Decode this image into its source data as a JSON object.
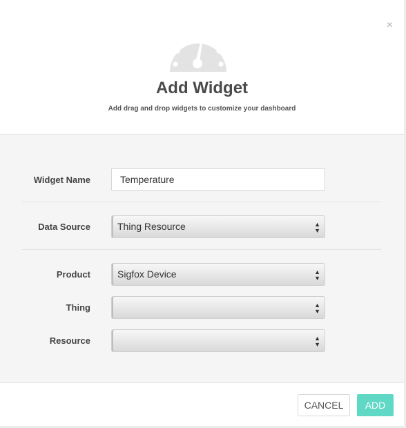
{
  "dialog": {
    "title": "Add Widget",
    "subtitle": "Add drag and drop widgets to customize your dashboard",
    "close_symbol": "×",
    "icon": "gauge-icon"
  },
  "form": {
    "widget_name": {
      "label": "Widget Name",
      "value": "Temperature"
    },
    "data_source": {
      "label": "Data Source",
      "value": "Thing Resource"
    },
    "product": {
      "label": "Product",
      "value": "Sigfox Device"
    },
    "thing": {
      "label": "Thing",
      "value": ""
    },
    "resource": {
      "label": "Resource",
      "value": ""
    },
    "select_arrows": "▲▼"
  },
  "footer": {
    "cancel_label": "CANCEL",
    "add_label": "ADD"
  },
  "colors": {
    "accent": "#5fd8c5",
    "gauge": "#e3e3e3",
    "body_bg": "#f5f5f5"
  }
}
